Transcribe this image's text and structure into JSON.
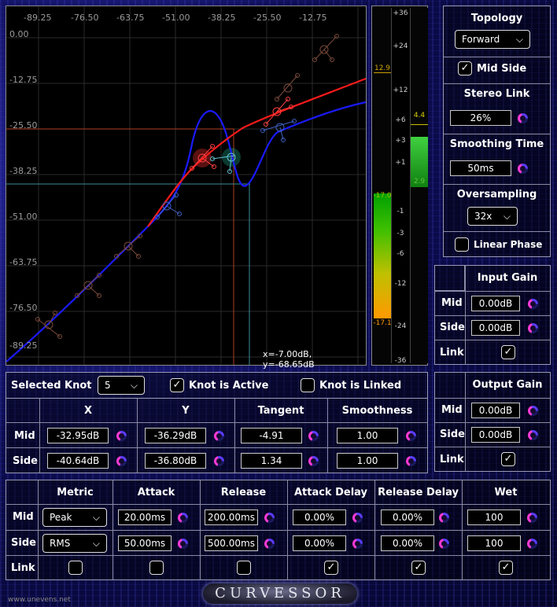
{
  "graph": {
    "x_ticks": [
      "-89.25",
      "-76.50",
      "-63.75",
      "-51.00",
      "-38.25",
      "-25.50",
      "-12.75"
    ],
    "y_ticks": [
      "0.00",
      "-12.75",
      "-25.50",
      "-38.25",
      "-51.00",
      "-63.75",
      "-76.50",
      "-89.25"
    ],
    "readout": "x=-7.00dB, y=-68.65dB"
  },
  "meters": {
    "scale": [
      "+36",
      "+24",
      "+12",
      "+6",
      "+3",
      "+1",
      "-1",
      "-3",
      "-6",
      "-12",
      "-24",
      "-36"
    ],
    "left_top": "12.9",
    "left_mid": "-17.0",
    "left_bot": "-17.1",
    "right_top": "4.4",
    "right_bot": "2.9"
  },
  "topology": {
    "title": "Topology",
    "value": "Forward"
  },
  "mid_side": {
    "label": "Mid Side",
    "checked": "✓"
  },
  "stereo_link": {
    "title": "Stereo Link",
    "value": "26%"
  },
  "smoothing": {
    "title": "Smoothing Time",
    "value": "50ms"
  },
  "oversampling": {
    "title": "Oversampling",
    "value": "32x"
  },
  "linear_phase": {
    "label": "Linear Phase",
    "checked": ""
  },
  "input_gain": {
    "title": "Input Gain",
    "mid_label": "Mid",
    "mid": "0.00dB",
    "side_label": "Side",
    "side": "0.00dB",
    "link_label": "Link",
    "link": "✓"
  },
  "output_gain": {
    "title": "Output Gain",
    "mid_label": "Mid",
    "mid": "0.00dB",
    "side_label": "Side",
    "side": "0.00dB",
    "link_label": "Link",
    "link": "✓"
  },
  "knot": {
    "selected_label": "Selected Knot",
    "selected_value": "5",
    "active_label": "Knot is Active",
    "active_checked": "✓",
    "linked_label": "Knot is Linked",
    "linked_checked": "",
    "headers": [
      "X",
      "Y",
      "Tangent",
      "Smoothness"
    ],
    "mid_label": "Mid",
    "side_label": "Side",
    "mid": [
      "-32.95dB",
      "-36.29dB",
      "-4.91",
      "1.00"
    ],
    "side": [
      "-40.64dB",
      "-36.80dB",
      "1.34",
      "1.00"
    ]
  },
  "dynamics": {
    "headers": [
      "Metric",
      "Attack",
      "Release",
      "Attack Delay",
      "Release Delay",
      "Wet"
    ],
    "mid_label": "Mid",
    "side_label": "Side",
    "link_label": "Link",
    "mid": {
      "metric": "Peak",
      "attack": "20.00ms",
      "release": "200.00ms",
      "attack_delay": "0.00%",
      "release_delay": "0.00%",
      "wet": "100"
    },
    "side": {
      "metric": "RMS",
      "attack": "50.00ms",
      "release": "500.00ms",
      "attack_delay": "0.00%",
      "release_delay": "0.00%",
      "wet": "100"
    },
    "link": [
      "",
      "",
      "",
      "✓",
      "✓",
      "✓"
    ]
  },
  "branding": {
    "logo": "CURVESSOR",
    "url": "www.unevens.net"
  },
  "colors": {
    "mid_curve": "#ff1a1a",
    "side_curve": "#1a1aff",
    "accent": "#ff3ad6",
    "meter_green": "#22cc22",
    "meter_orange": "#ff9900"
  }
}
